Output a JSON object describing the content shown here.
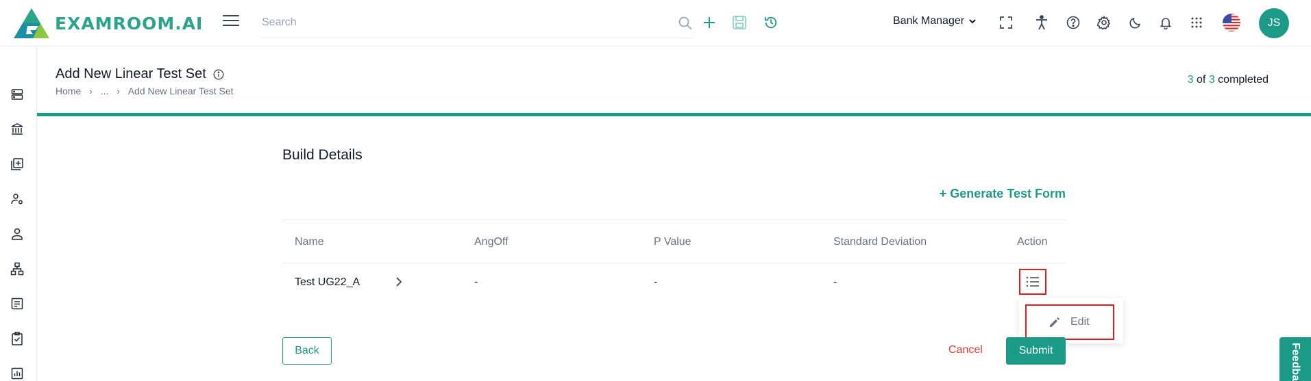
{
  "header": {
    "logo_text": "EXAMROOM.AI",
    "search_placeholder": "Search",
    "role": "Bank Manager",
    "avatar_initials": "JS",
    "brand_color": "#1b9b87"
  },
  "sidebar": {
    "icons": [
      "server-icon",
      "bank-icon",
      "add-document-icon",
      "user-settings-icon",
      "user-icon",
      "hierarchy-icon",
      "list-document-icon",
      "clipboard-check-icon",
      "bar-chart-icon"
    ]
  },
  "page": {
    "title": "Add New Linear Test Set",
    "breadcrumb": [
      "Home",
      "...",
      "Add New Linear Test Set"
    ],
    "progress": {
      "current": "3",
      "of_label": "of",
      "total": "3",
      "completed_label": "completed"
    }
  },
  "build": {
    "section_title": "Build Details",
    "generate_link": "+ Generate Test Form",
    "columns": [
      "Name",
      "AngOff",
      "P Value",
      "Standard Deviation",
      "Action"
    ],
    "rows": [
      {
        "name": "Test UG22_A",
        "angoff": "-",
        "p_value": "-",
        "std_dev": "-"
      }
    ],
    "menu_edit": "Edit"
  },
  "footer": {
    "back": "Back",
    "cancel": "Cancel",
    "submit": "Submit",
    "feedback": "Feedback"
  }
}
